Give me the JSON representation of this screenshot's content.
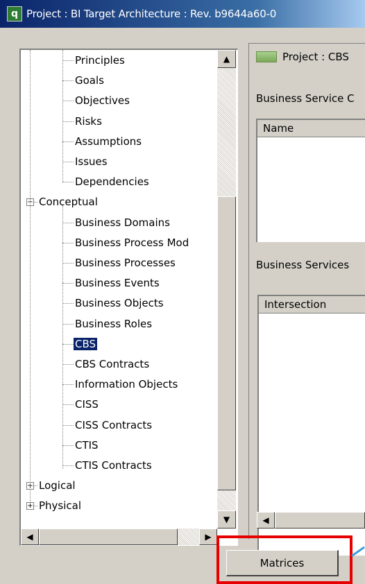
{
  "window": {
    "title": "Project : BI Target Architecture : Rev. b9644a60-0"
  },
  "tree": {
    "items": [
      {
        "label": "Principles",
        "level": 2
      },
      {
        "label": "Goals",
        "level": 2
      },
      {
        "label": "Objectives",
        "level": 2
      },
      {
        "label": "Risks",
        "level": 2
      },
      {
        "label": "Assumptions",
        "level": 2
      },
      {
        "label": "Issues",
        "level": 2
      },
      {
        "label": "Dependencies",
        "level": 2
      },
      {
        "label": "Conceptual",
        "level": 1,
        "expander": "−"
      },
      {
        "label": "Business Domains",
        "level": 2
      },
      {
        "label": "Business Process Mod",
        "level": 2
      },
      {
        "label": "Business Processes",
        "level": 2
      },
      {
        "label": "Business Events",
        "level": 2
      },
      {
        "label": "Business Objects",
        "level": 2
      },
      {
        "label": "Business Roles",
        "level": 2
      },
      {
        "label": "CBS",
        "level": 2,
        "selected": true
      },
      {
        "label": "CBS Contracts",
        "level": 2
      },
      {
        "label": "Information Objects",
        "level": 2
      },
      {
        "label": "CISS",
        "level": 2
      },
      {
        "label": "CISS Contracts",
        "level": 2
      },
      {
        "label": "CTIS",
        "level": 2
      },
      {
        "label": "CTIS Contracts",
        "level": 2
      },
      {
        "label": "Logical",
        "level": 1,
        "expander": "+"
      },
      {
        "label": "Physical",
        "level": 1,
        "expander": "+"
      }
    ]
  },
  "right": {
    "header": "Project : CBS",
    "section1_label": "Business Service C",
    "grid1_header": "Name",
    "section2_label": "Business Services",
    "grid2_header": "Intersection"
  },
  "buttons": {
    "matrices": "Matrices"
  },
  "icons": {
    "scroll_up": "▲",
    "scroll_down": "▼",
    "scroll_left": "◀",
    "scroll_right": "▶"
  },
  "colors": {
    "selection": "#0a246a",
    "highlight_box": "#e60000"
  }
}
